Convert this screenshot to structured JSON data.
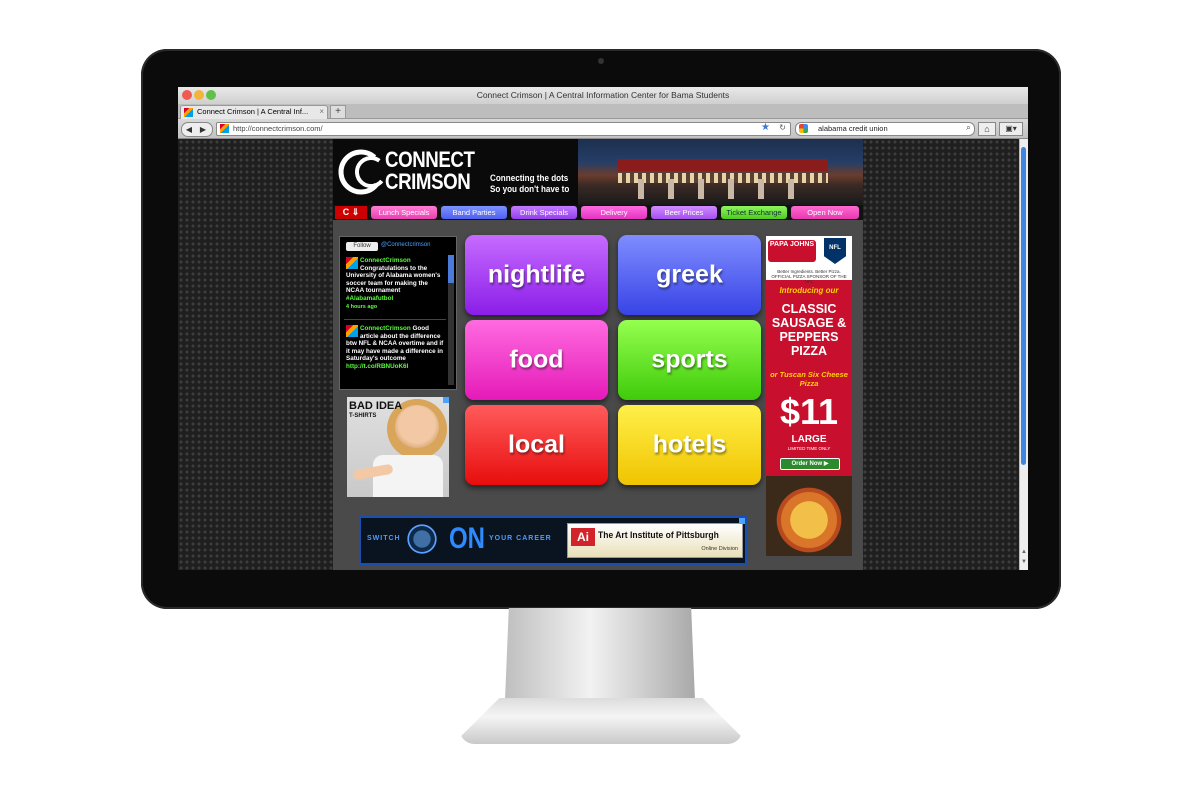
{
  "window": {
    "title": "Connect Crimson | A Central Information Center for Bama Students"
  },
  "browser": {
    "tab_label": "Connect Crimson | A Central Inf...",
    "new_tab": "+",
    "url": "http://connectcrimson.com/",
    "search_query": "alabama credit union",
    "back_icon": "back-arrow-icon",
    "forward_icon": "forward-arrow-icon"
  },
  "site": {
    "logo_line1": "CONNECT",
    "logo_line2": "CRIMSON",
    "tagline1": "Connecting the dots",
    "tagline2": "So you don't have to",
    "nav": [
      {
        "label": "Lunch Specials"
      },
      {
        "label": "Band Parties"
      },
      {
        "label": "Drink Specials"
      },
      {
        "label": "Delivery"
      },
      {
        "label": "Beer Prices"
      },
      {
        "label": "Ticket Exchange"
      },
      {
        "label": "Open Now"
      }
    ],
    "tiles": [
      {
        "label": "nightlife"
      },
      {
        "label": "greek"
      },
      {
        "label": "food"
      },
      {
        "label": "sports"
      },
      {
        "label": "local"
      },
      {
        "label": "hotels"
      }
    ]
  },
  "twitter": {
    "follow": "Follow",
    "handle": "@Connectcrimson",
    "tweets": [
      {
        "name": "ConnectCrimson",
        "text": "Congratulations to the University of Alabama women's soccer team for making the NCAA tournament",
        "tag": "#Alabamafutbol",
        "time": "4 hours ago"
      },
      {
        "name": "ConnectCrimson",
        "text": "Good article about the difference btw NFL & NCAA overtime and if it may have made a difference in Saturday's outcome",
        "link": "http://t.co/RBNUoK6I"
      }
    ]
  },
  "ads": {
    "badidea": {
      "line1": "BAD IDEA",
      "line2": "T-SHIRTS"
    },
    "papajohns": {
      "brand": "PAPA JOHNS",
      "slogan": "Better Ingredients. Better Pizza.",
      "nfl": "NFL",
      "sponsor": "OFFICIAL PIZZA SPONSOR OF THE NFL",
      "intro": "Introducing our",
      "headline": "CLASSIC SAUSAGE & PEPPERS PIZZA",
      "or_text": "or Tuscan Six Cheese Pizza",
      "price": "$11",
      "size": "LARGE",
      "limited": "LIMITED TIME ONLY",
      "cta": "Order Now ▶"
    },
    "artinstitute": {
      "switch": "SWITCH",
      "on": "ON",
      "career": "YOUR CAREER",
      "logo": "Ai",
      "name": "The Art Institute of Pittsburgh",
      "division": "Online Division"
    }
  }
}
